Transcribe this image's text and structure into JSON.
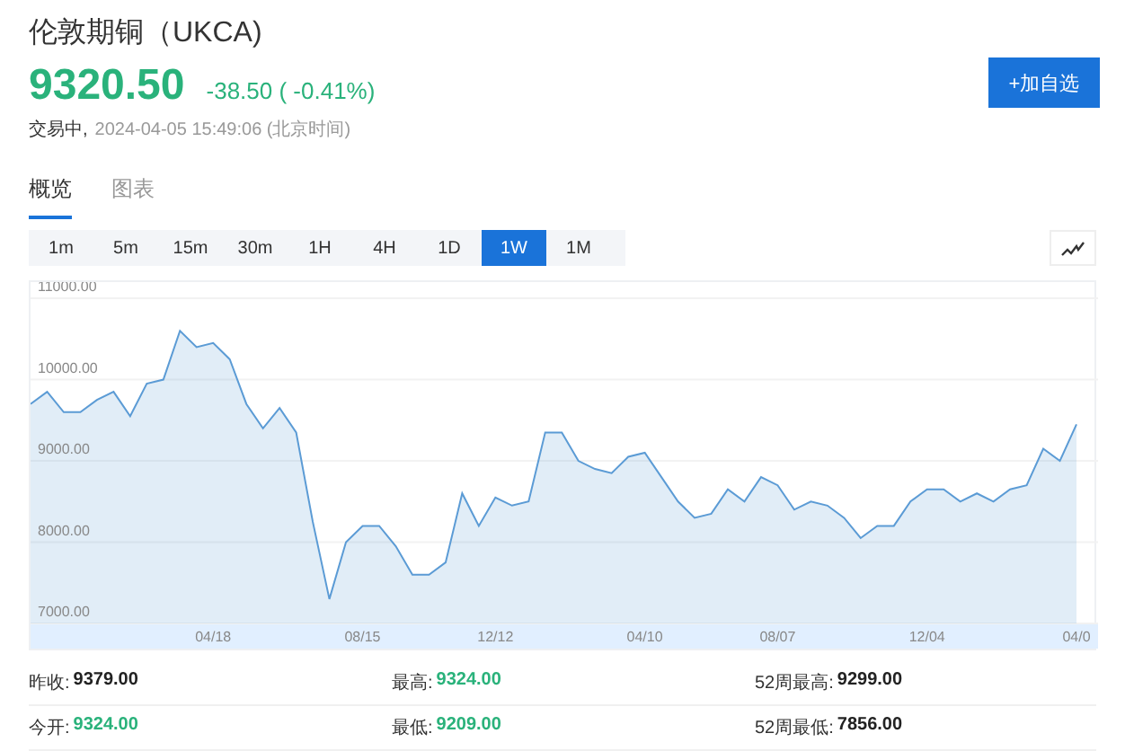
{
  "header": {
    "title": "伦敦期铜（UKCA)",
    "price": "9320.50",
    "change": "-38.50 ( -0.41%)",
    "status": "交易中,",
    "time": "2024-04-05 15:49:06 (北京时间)",
    "watch_button": "+加自选"
  },
  "tabs": [
    {
      "label": "概览",
      "selected": true
    },
    {
      "label": "图表",
      "selected": false
    }
  ],
  "periods": [
    {
      "label": "1m",
      "selected": false
    },
    {
      "label": "5m",
      "selected": false
    },
    {
      "label": "15m",
      "selected": false
    },
    {
      "label": "30m",
      "selected": false
    },
    {
      "label": "1H",
      "selected": false
    },
    {
      "label": "4H",
      "selected": false
    },
    {
      "label": "1D",
      "selected": false
    },
    {
      "label": "1W",
      "selected": true
    },
    {
      "label": "1M",
      "selected": false
    }
  ],
  "chart_data": {
    "type": "area",
    "categories": [
      null,
      null,
      null,
      null,
      null,
      null,
      null,
      null,
      null,
      null,
      null,
      "04/18",
      null,
      null,
      null,
      null,
      null,
      null,
      null,
      null,
      "08/15",
      null,
      null,
      null,
      null,
      null,
      null,
      null,
      "12/12",
      null,
      null,
      null,
      null,
      null,
      null,
      null,
      null,
      "04/10",
      null,
      null,
      null,
      null,
      null,
      null,
      null,
      "08/07",
      null,
      null,
      null,
      null,
      null,
      null,
      null,
      null,
      "12/04",
      null,
      null,
      null,
      null,
      null,
      null,
      null,
      null,
      "04/0"
    ],
    "series": [
      {
        "color": "#5b9bd5",
        "values": [
          9700,
          9850,
          9600,
          9600,
          9750,
          9850,
          9550,
          9950,
          10000,
          10600,
          10400,
          10450,
          10250,
          9700,
          9400,
          9650,
          9350,
          8250,
          7300,
          8000,
          8200,
          8200,
          7950,
          7600,
          7600,
          7750,
          8600,
          8200,
          8550,
          8450,
          8500,
          9350,
          9350,
          9000,
          8900,
          8850,
          9050,
          9100,
          8800,
          8500,
          8300,
          8350,
          8650,
          8500,
          8800,
          8700,
          8400,
          8500,
          8450,
          8300,
          8050,
          8200,
          8200,
          8500,
          8650,
          8650,
          8500,
          8600,
          8500,
          8650,
          8700,
          9150,
          9000,
          9450
        ]
      }
    ],
    "ylim": [
      7000,
      11200
    ],
    "yticks": [
      {
        "value": 7000,
        "label": "7000.00"
      },
      {
        "value": 8000,
        "label": "8000.00"
      },
      {
        "value": 9000,
        "label": "9000.00"
      },
      {
        "value": 10000,
        "label": "10000.00"
      },
      {
        "value": 11000,
        "label": "11000.00"
      }
    ],
    "grid": true
  },
  "stats": [
    [
      {
        "label": "昨收:",
        "value": "9379.00",
        "kind": "plain"
      },
      {
        "label": "最高:",
        "value": "9324.00",
        "kind": "green"
      },
      {
        "label": "52周最高:",
        "value": "9299.00",
        "kind": "plain"
      }
    ],
    [
      {
        "label": "今开:",
        "value": "9324.00",
        "kind": "green"
      },
      {
        "label": "最低:",
        "value": "9209.00",
        "kind": "green"
      },
      {
        "label": "52周最低:",
        "value": "7856.00",
        "kind": "plain"
      }
    ]
  ]
}
